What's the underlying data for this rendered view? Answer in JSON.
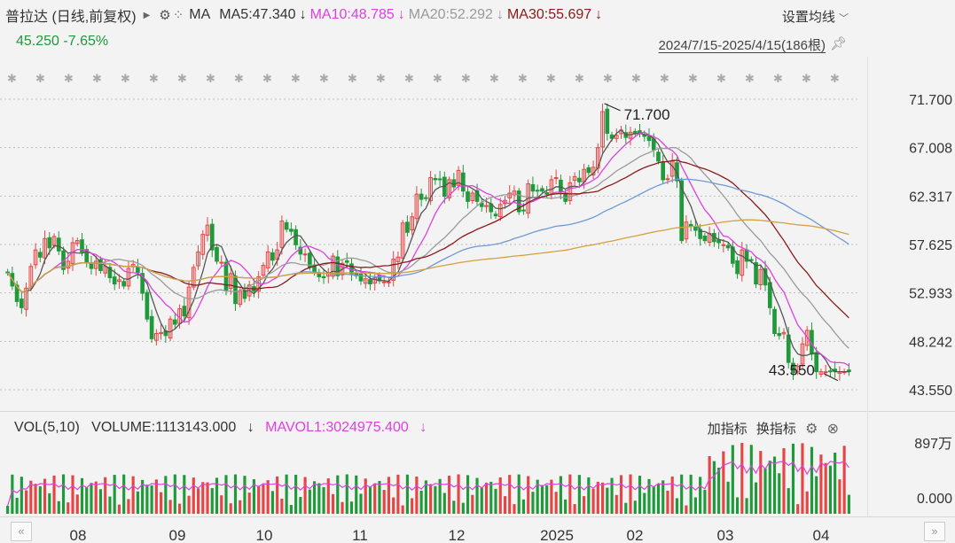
{
  "header": {
    "title": "普拉达 (日线,前复权)",
    "ma_label": "MA",
    "ma5": "MA5:47.340",
    "ma10": "MA10:48.785",
    "ma20": "MA20:52.292",
    "ma30": "MA30:55.697",
    "arrow": "↓",
    "settings": "设置均线"
  },
  "quote": {
    "price": "45.250",
    "change_pct": "-7.65%"
  },
  "range_label": "2024/7/15-2025/4/15(186根)",
  "annotations": {
    "high": "71.700",
    "low": "43.550"
  },
  "volume_header": {
    "vol": "VOL(5,10)",
    "volume": "VOLUME:1113143.000",
    "mavol1": "MAVOL1:3024975.400",
    "add_indicator": "加指标",
    "switch_indicator": "换指标"
  },
  "colors": {
    "up": "#e64545",
    "down": "#1f9a3a",
    "ma5": "#555555",
    "ma10": "#e040e0",
    "ma20": "#9a9a9a",
    "ma30": "#8b1a1a",
    "ma60": "#6f9ad6",
    "ma120": "#d4a040"
  },
  "chart_data": {
    "type": "candlestick",
    "x_range": [
      "2024/7/15",
      "2025/4/15"
    ],
    "bars": 186,
    "x_ticks": [
      "08",
      "09",
      "10",
      "11",
      "12",
      "2025",
      "02",
      "03",
      "04"
    ],
    "y_ticks": [
      "71.700",
      "67.008",
      "62.317",
      "57.625",
      "52.933",
      "48.242",
      "43.550"
    ],
    "ylim": [
      43.55,
      71.7
    ],
    "closes": [
      54.9,
      53.6,
      52.1,
      51.5,
      53.4,
      55.5,
      57.1,
      56.4,
      58.2,
      57.3,
      58.4,
      57.0,
      55.2,
      56.0,
      57.8,
      58.0,
      56.9,
      55.9,
      55.3,
      56.0,
      55.1,
      55.5,
      54.4,
      53.8,
      54.2,
      53.6,
      55.3,
      55.7,
      54.9,
      52.9,
      50.4,
      48.5,
      49.0,
      49.1,
      48.8,
      50.4,
      49.9,
      51.4,
      50.7,
      53.5,
      55.4,
      56.9,
      58.6,
      59.5,
      57.1,
      56.0,
      55.9,
      53.2,
      54.8,
      51.9,
      53.1,
      52.4,
      53.7,
      53.1,
      54.5,
      55.6,
      56.9,
      56.1,
      57.1,
      59.9,
      59.1,
      58.9,
      57.6,
      56.7,
      56.7,
      55.4,
      55.0,
      54.5,
      54.4,
      54.8,
      56.5,
      54.6,
      55.8,
      55.9,
      54.8,
      54.6,
      54.1,
      54.3,
      53.8,
      54.4,
      54.1,
      54.0,
      54.0,
      56.2,
      56.4,
      59.7,
      58.8,
      60.3,
      62.5,
      62.0,
      62.1,
      64.1,
      63.9,
      63.9,
      62.3,
      63.9,
      63.2,
      64.8,
      62.8,
      61.8,
      62.6,
      61.8,
      61.3,
      61.4,
      60.8,
      60.4,
      61.5,
      61.9,
      62.6,
      62.8,
      60.8,
      60.9,
      63.5,
      62.8,
      62.8,
      62.8,
      62.5,
      63.9,
      64.1,
      62.7,
      61.8,
      63.6,
      64.2,
      63.7,
      64.9,
      64.6,
      65.1,
      67.0,
      70.5,
      68.4,
      67.9,
      68.2,
      68.7,
      68.0,
      68.5,
      68.4,
      68.4,
      68.1,
      67.7,
      66.8,
      65.7,
      63.9,
      64.0,
      65.7,
      63.8,
      58.0,
      59.8,
      59.4,
      59.0,
      58.2,
      58.0,
      58.7,
      57.9,
      57.8,
      57.6,
      57.3,
      55.8,
      54.8,
      57.1,
      56.0,
      56.1,
      53.8,
      55.2,
      53.7,
      51.5,
      49.0,
      48.8,
      49.1,
      46.2,
      45.2,
      45.8,
      48.0,
      49.3,
      47.0,
      45.3,
      45.3,
      45.3,
      45.3,
      45.3,
      45.3,
      45.3,
      45.3
    ],
    "ma_values": {
      "MA5": 47.34,
      "MA10": 48.785,
      "MA20": 52.292,
      "MA30": 55.697
    },
    "volume_axis": [
      "897万",
      "0.000"
    ]
  }
}
